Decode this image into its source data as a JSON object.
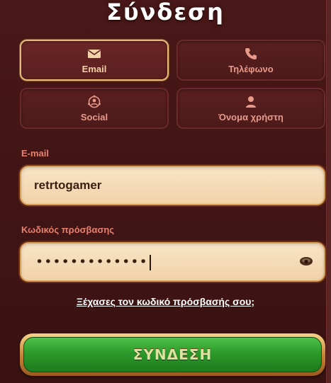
{
  "title": "Σύνδεση",
  "tabs": [
    {
      "label": "Email",
      "icon": "envelope-icon",
      "active": true
    },
    {
      "label": "Τηλέφωνο",
      "icon": "phone-icon",
      "active": false
    },
    {
      "label": "Social",
      "icon": "social-icon",
      "active": false
    },
    {
      "label": "Όνομα χρήστη",
      "icon": "user-icon",
      "active": false
    }
  ],
  "email_field": {
    "label": "E-mail",
    "value": "retrtogamer"
  },
  "password_field": {
    "label": "Κωδικός πρόσβασης",
    "masked_value": "•••••••••••••"
  },
  "forgot_link": "Ξέχασες τον κωδικό πρόσβασής σου;",
  "login_button": "ΣΥΝΔΕΣΗ",
  "colors": {
    "background": "#4a1818",
    "accent_gold": "#e6b97a",
    "label_red": "#e88070",
    "button_green": "#2c9a2a"
  }
}
